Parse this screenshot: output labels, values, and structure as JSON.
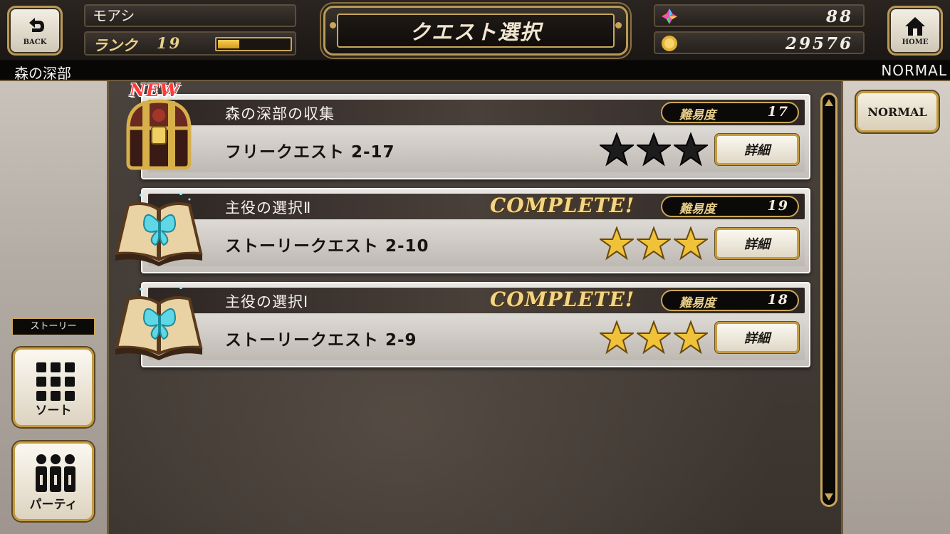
{
  "header": {
    "back_label": "BACK",
    "home_label": "HOME",
    "player_name": "モアシ",
    "rank_label": "ランク",
    "rank_value": "19",
    "rank_progress": 0.3,
    "screen_title": "クエスト選択",
    "gems": "88",
    "gold": "29576"
  },
  "subbar": {
    "area_name": "森の深部",
    "mode": "NORMAL"
  },
  "quests": [
    {
      "name": "森の深部の収集",
      "subtitle": "フリークエスト 2-17",
      "difficulty_label": "難易度",
      "difficulty": "17",
      "stars_earned": 0,
      "complete": "",
      "badge": "NEW",
      "icon": "treasure-chest-icon",
      "detail_label": "詳細"
    },
    {
      "name": "主役の選択Ⅱ",
      "subtitle": "ストーリークエスト 2-10",
      "difficulty_label": "難易度",
      "difficulty": "19",
      "stars_earned": 3,
      "complete": "COMPLETE!",
      "badge": "",
      "icon": "open-book-butterfly-icon",
      "detail_label": "詳細"
    },
    {
      "name": "主役の選択Ⅰ",
      "subtitle": "ストーリークエスト 2-9",
      "difficulty_label": "難易度",
      "difficulty": "18",
      "stars_earned": 3,
      "complete": "COMPLETE!",
      "badge": "",
      "icon": "open-book-butterfly-icon",
      "detail_label": "詳細"
    }
  ],
  "right_panel": {
    "difficulty_button": "NORMAL"
  },
  "left_panel": {
    "filter_label": "ストーリー",
    "sort_label": "ソート",
    "party_label": "パーティ"
  },
  "colors": {
    "gold_accent": "#c9a65a",
    "star_gold": "#f0c23a",
    "star_empty": "#1c1c1c",
    "new_red": "#ff3a3a"
  }
}
